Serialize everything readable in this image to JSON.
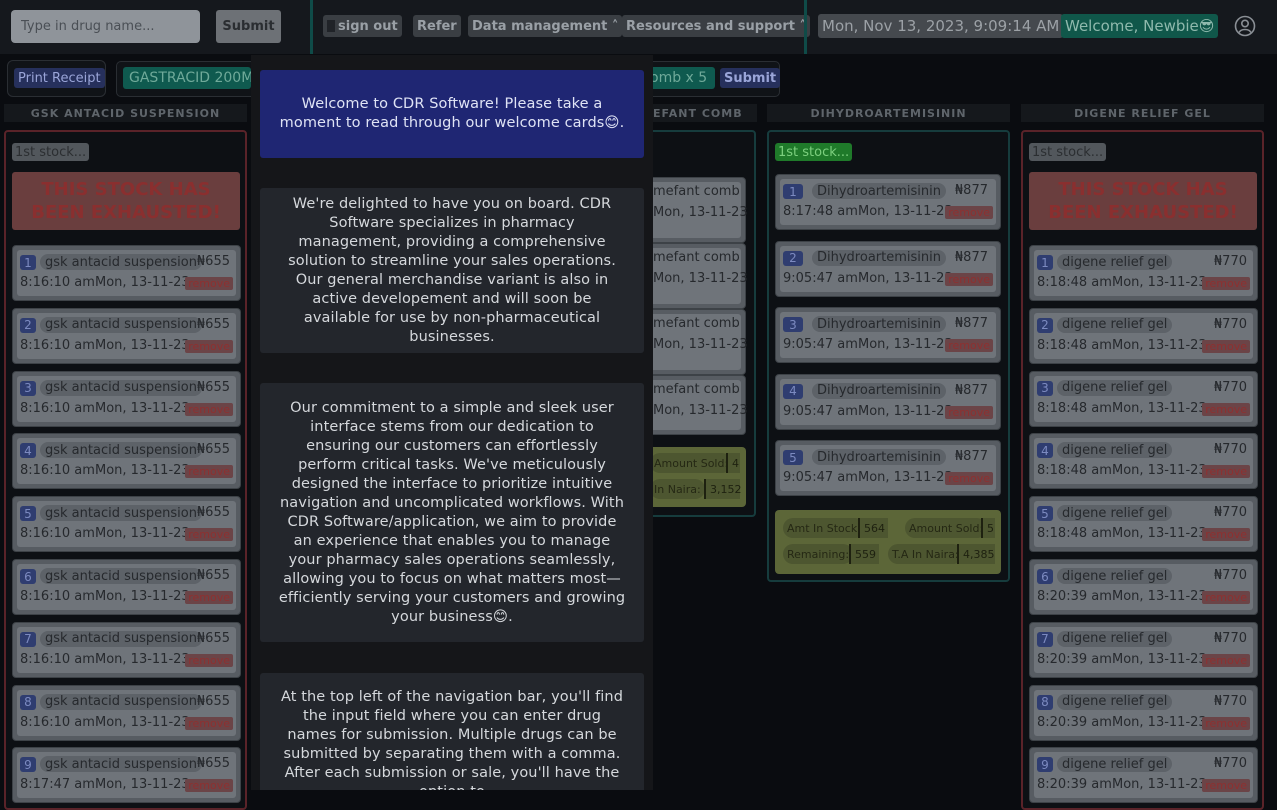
{
  "nav": {
    "search_placeholder": "Type in drug name...",
    "submit_label": "Submit",
    "sign_out_label": "sign out",
    "refer_label": "Refer",
    "data_management_label": "Data management ˄",
    "resources_label": "Resources and support ˄",
    "datetime": "Mon, Nov 13, 2023, 9:09:14 AM",
    "welcome": "Welcome, Newbie😎"
  },
  "receipt": {
    "print_label": "Print Receipt",
    "tag_left": "GASTRACID 200M",
    "tag_right": "omb x 5",
    "submit_label": "Submit"
  },
  "columns": [
    {
      "header": "GSK ANTACID SUSPENSION",
      "stock_label": "1st stock...",
      "exhausted_text": "THIS STOCK HAS BEEN EXHAUSTED!",
      "items": [
        {
          "n": "1",
          "name": "gsk antacid suspension",
          "price": "₦655",
          "time": "8:16:10 am",
          "date": "Mon, 13-11-23",
          "remove": "remove"
        },
        {
          "n": "2",
          "name": "gsk antacid suspension",
          "price": "₦655",
          "time": "8:16:10 am",
          "date": "Mon, 13-11-23",
          "remove": "remove"
        },
        {
          "n": "3",
          "name": "gsk antacid suspension",
          "price": "₦655",
          "time": "8:16:10 am",
          "date": "Mon, 13-11-23",
          "remove": "remove"
        },
        {
          "n": "4",
          "name": "gsk antacid suspension",
          "price": "₦655",
          "time": "8:16:10 am",
          "date": "Mon, 13-11-23",
          "remove": "remove"
        },
        {
          "n": "5",
          "name": "gsk antacid suspension",
          "price": "₦655",
          "time": "8:16:10 am",
          "date": "Mon, 13-11-23",
          "remove": "remove"
        },
        {
          "n": "6",
          "name": "gsk antacid suspension",
          "price": "₦655",
          "time": "8:16:10 am",
          "date": "Mon, 13-11-23",
          "remove": "remove"
        },
        {
          "n": "7",
          "name": "gsk antacid suspension",
          "price": "₦655",
          "time": "8:16:10 am",
          "date": "Mon, 13-11-23",
          "remove": "remove"
        },
        {
          "n": "8",
          "name": "gsk antacid suspension",
          "price": "₦655",
          "time": "8:16:10 am",
          "date": "Mon, 13-11-23",
          "remove": "remove"
        },
        {
          "n": "9",
          "name": "gsk antacid suspension",
          "price": "₦655",
          "time": "8:17:47 am",
          "date": "Mon, 13-11-23",
          "remove": "remove"
        }
      ]
    },
    {
      "header": "EFANT COMB",
      "items": [
        {
          "name": "mefant comb",
          "date": "Mon, 13-11-23"
        },
        {
          "name": "mefant comb",
          "date": "Mon, 13-11-23"
        },
        {
          "name": "mefant comb",
          "date": "Mon, 13-11-23"
        },
        {
          "name": "mefant comb",
          "date": "Mon, 13-11-23"
        }
      ],
      "amount_sold_label": "Amount Sold:",
      "amount_sold": "4",
      "ta_label": "In Naira:",
      "ta_value": "3,152"
    },
    {
      "header": "DIHYDROARTEMISININ",
      "stock_label": "1st stock...",
      "items": [
        {
          "n": "1",
          "name": "Dihydroartemisinin",
          "price": "₦877",
          "time": "8:17:48 am",
          "date": "Mon, 13-11-23",
          "remove": "remove"
        },
        {
          "n": "2",
          "name": "Dihydroartemisinin",
          "price": "₦877",
          "time": "9:05:47 am",
          "date": "Mon, 13-11-23",
          "remove": "remove"
        },
        {
          "n": "3",
          "name": "Dihydroartemisinin",
          "price": "₦877",
          "time": "9:05:47 am",
          "date": "Mon, 13-11-23",
          "remove": "remove"
        },
        {
          "n": "4",
          "name": "Dihydroartemisinin",
          "price": "₦877",
          "time": "9:05:47 am",
          "date": "Mon, 13-11-23",
          "remove": "remove"
        },
        {
          "n": "5",
          "name": "Dihydroartemisinin",
          "price": "₦877",
          "time": "9:05:47 am",
          "date": "Mon, 13-11-23",
          "remove": "remove"
        }
      ],
      "amt_in_stock_label": "Amt In Stock:",
      "amt_in_stock": "564",
      "amount_sold_label": "Amount Sold:",
      "amount_sold": "5",
      "remaining_label": "Remaining:",
      "remaining": "559",
      "ta_label": "T.A In Naira:",
      "ta_value": "4,385"
    },
    {
      "header": "DIGENE RELIEF GEL",
      "stock_label": "1st stock...",
      "exhausted_text": "THIS STOCK HAS BEEN EXHAUSTED!",
      "items": [
        {
          "n": "1",
          "name": "digene relief gel",
          "price": "₦770",
          "time": "8:18:48 am",
          "date": "Mon, 13-11-23",
          "remove": "remove"
        },
        {
          "n": "2",
          "name": "digene relief gel",
          "price": "₦770",
          "time": "8:18:48 am",
          "date": "Mon, 13-11-23",
          "remove": "remove"
        },
        {
          "n": "3",
          "name": "digene relief gel",
          "price": "₦770",
          "time": "8:18:48 am",
          "date": "Mon, 13-11-23",
          "remove": "remove"
        },
        {
          "n": "4",
          "name": "digene relief gel",
          "price": "₦770",
          "time": "8:18:48 am",
          "date": "Mon, 13-11-23",
          "remove": "remove"
        },
        {
          "n": "5",
          "name": "digene relief gel",
          "price": "₦770",
          "time": "8:18:48 am",
          "date": "Mon, 13-11-23",
          "remove": "remove"
        },
        {
          "n": "6",
          "name": "digene relief gel",
          "price": "₦770",
          "time": "8:20:39 am",
          "date": "Mon, 13-11-23",
          "remove": "remove"
        },
        {
          "n": "7",
          "name": "digene relief gel",
          "price": "₦770",
          "time": "8:20:39 am",
          "date": "Mon, 13-11-23",
          "remove": "remove"
        },
        {
          "n": "8",
          "name": "digene relief gel",
          "price": "₦770",
          "time": "8:20:39 am",
          "date": "Mon, 13-11-23",
          "remove": "remove"
        },
        {
          "n": "9",
          "name": "digene relief gel",
          "price": "₦770",
          "time": "8:20:39 am",
          "date": "Mon, 13-11-23",
          "remove": "remove"
        }
      ]
    }
  ],
  "modal": {
    "card1": "Welcome to CDR Software! Please take a moment to read through our welcome cards😊.",
    "card2": "We're delighted to have you on board. CDR Software specializes in pharmacy management, providing a comprehensive solution to streamline your sales operations. Our general merchandise variant is also in active developement and will soon be available for use by non-pharmaceutical businesses.",
    "card3": "Our commitment to a simple and sleek user interface stems from our dedication to ensuring our customers can effortlessly perform critical tasks. We've meticulously designed the interface to prioritize intuitive navigation and uncomplicated workflows. With CDR Software/application, we aim to provide an experience that enables you to manage your pharmacy sales operations seamlessly, allowing you to focus on what matters most—efficiently serving your customers and growing your business😊.",
    "card4": "At the top left of the navigation bar, you'll find the input field where you can enter drug names for submission. Multiple drugs can be submitted by separating them with a comma. After each submission or sale, you'll have the option to"
  },
  "colors": {
    "accent_teal": "#0f4b48",
    "modal_primary": "#1f2673",
    "exhausted_red": "#8a2f2f"
  }
}
